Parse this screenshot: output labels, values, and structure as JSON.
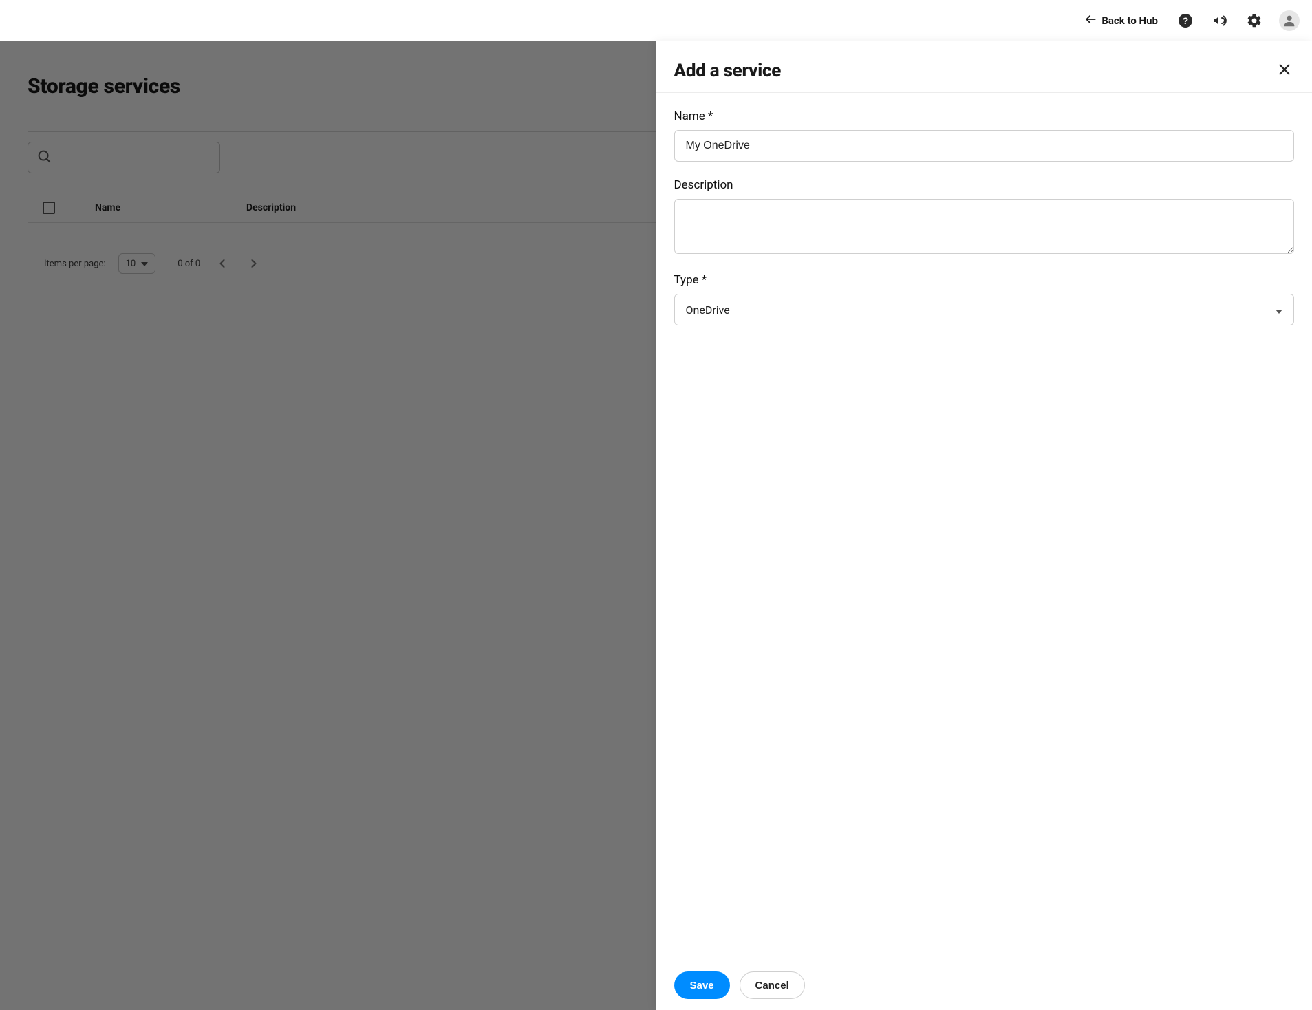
{
  "header": {
    "back_label": "Back to Hub"
  },
  "page": {
    "title": "Storage services",
    "columns": {
      "name": "Name",
      "description": "Description"
    },
    "paginator": {
      "items_per_page_label": "Items per page:",
      "page_size": "10",
      "range": "0 of 0"
    }
  },
  "drawer": {
    "title": "Add a service",
    "fields": {
      "name": {
        "label": "Name *",
        "value": "My OneDrive"
      },
      "description": {
        "label": "Description",
        "value": ""
      },
      "type": {
        "label": "Type *",
        "value": "OneDrive"
      }
    },
    "buttons": {
      "save": "Save",
      "cancel": "Cancel"
    }
  }
}
